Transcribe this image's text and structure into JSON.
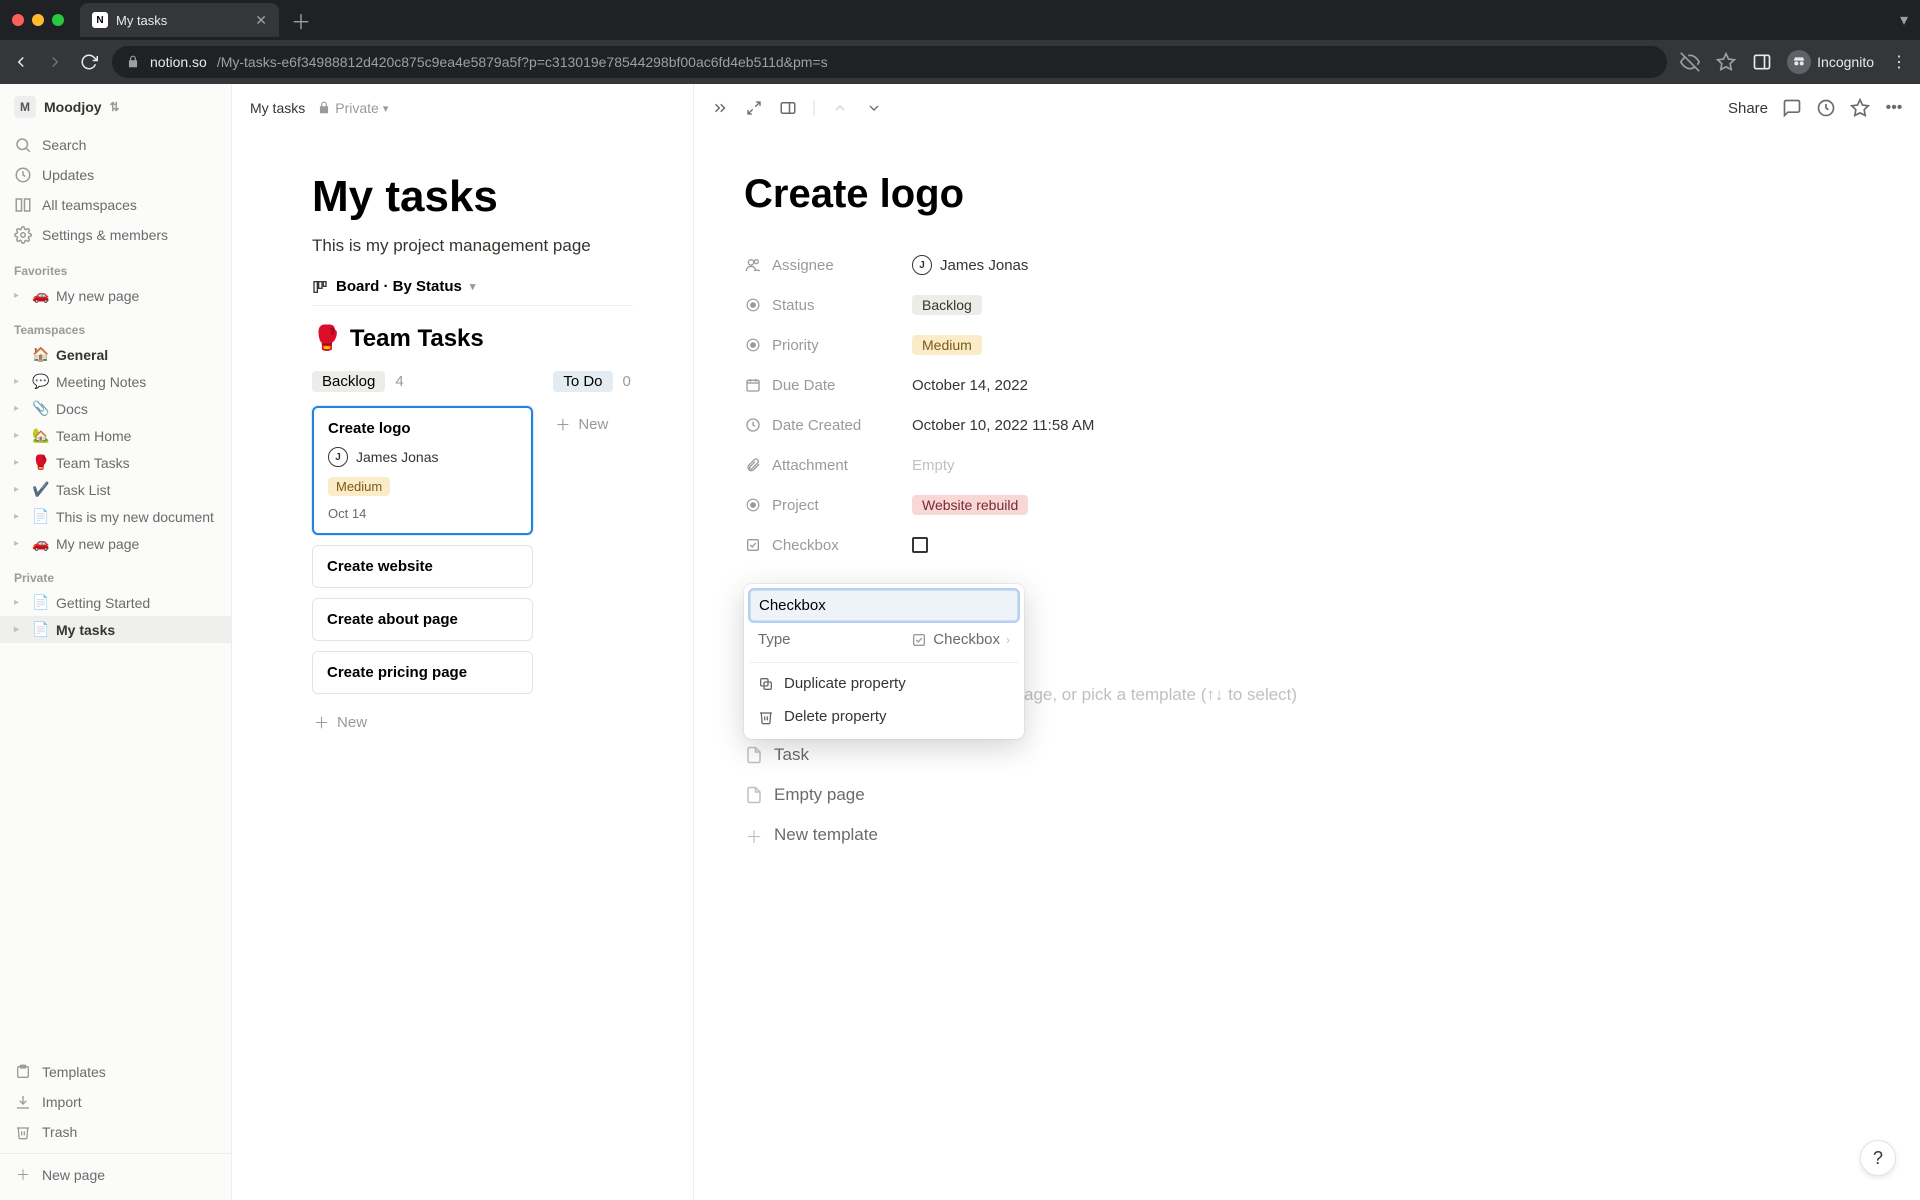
{
  "browser": {
    "tab_title": "My tasks",
    "url_host": "notion.so",
    "url_path": "/My-tasks-e6f34988812d420c875c9ea4e5879a5f?p=c313019e78544298bf00ac6fd4eb511d&pm=s",
    "incognito_label": "Incognito"
  },
  "workspace": {
    "initial": "M",
    "name": "Moodjoy"
  },
  "sidebar_top": [
    {
      "icon": "search-icon",
      "label": "Search"
    },
    {
      "icon": "clock-icon",
      "label": "Updates"
    },
    {
      "icon": "teamspaces-icon",
      "label": "All teamspaces"
    },
    {
      "icon": "gear-icon",
      "label": "Settings & members"
    }
  ],
  "sidebar_sections": {
    "favorites_label": "Favorites",
    "favorites": [
      {
        "emoji": "🚗",
        "label": "My new page"
      }
    ],
    "teamspaces_label": "Teamspaces",
    "teamspaces": [
      {
        "emoji": "🏠",
        "label": "General",
        "top": true
      },
      {
        "emoji": "💬",
        "label": "Meeting Notes"
      },
      {
        "emoji": "📎",
        "label": "Docs"
      },
      {
        "emoji": "🏡",
        "label": "Team Home"
      },
      {
        "emoji": "🥊",
        "label": "Team Tasks"
      },
      {
        "emoji": "✔️",
        "label": "Task List"
      },
      {
        "emoji": "📄",
        "label": "This is my new document"
      },
      {
        "emoji": "🚗",
        "label": "My new page"
      }
    ],
    "private_label": "Private",
    "private": [
      {
        "emoji": "📄",
        "label": "Getting Started"
      },
      {
        "emoji": "📄",
        "label": "My tasks",
        "selected": true
      }
    ]
  },
  "sidebar_bottom": [
    {
      "icon": "template-icon",
      "label": "Templates"
    },
    {
      "icon": "import-icon",
      "label": "Import"
    },
    {
      "icon": "trash-icon",
      "label": "Trash"
    }
  ],
  "new_page_label": "New page",
  "breadcrumb": {
    "page": "My tasks",
    "visibility": "Private"
  },
  "topbar": {
    "share": "Share"
  },
  "page": {
    "title": "My tasks",
    "subtitle": "This is my project management page",
    "view_label": "Board · By Status",
    "db_emoji": "🥊",
    "db_title": "Team Tasks"
  },
  "board": {
    "columns": [
      {
        "name": "Backlog",
        "count": "4",
        "tag_class": "",
        "cards": [
          {
            "title": "Create logo",
            "assignee": "James Jonas",
            "priority": "Medium",
            "date": "Oct 14",
            "selected": true
          },
          {
            "title": "Create website"
          },
          {
            "title": "Create about page"
          },
          {
            "title": "Create pricing page"
          }
        ],
        "add": "New"
      },
      {
        "name": "To Do",
        "count": "0",
        "tag_class": "todo",
        "add": "New"
      }
    ]
  },
  "detail": {
    "title": "Create logo",
    "properties": [
      {
        "icon": "person-icon",
        "label": "Assignee",
        "kind": "person",
        "value": "James Jonas"
      },
      {
        "icon": "status-icon",
        "label": "Status",
        "kind": "tag",
        "tag_class": "backlog",
        "value": "Backlog"
      },
      {
        "icon": "status-icon",
        "label": "Priority",
        "kind": "tag",
        "tag_class": "medium",
        "value": "Medium"
      },
      {
        "icon": "calendar-icon",
        "label": "Due Date",
        "kind": "text",
        "value": "October 14, 2022"
      },
      {
        "icon": "clock-icon",
        "label": "Date Created",
        "kind": "text",
        "value": "October 10, 2022 11:58 AM"
      },
      {
        "icon": "attachment-icon",
        "label": "Attachment",
        "kind": "empty",
        "value": "Empty"
      },
      {
        "icon": "status-icon",
        "label": "Project",
        "kind": "tag",
        "tag_class": "project",
        "value": "Website rebuild"
      },
      {
        "icon": "checkbox-icon",
        "label": "Checkbox",
        "kind": "checkbox"
      }
    ],
    "popover": {
      "name_value": "Checkbox",
      "type_label": "Type",
      "type_value": "Checkbox",
      "duplicate": "Duplicate property",
      "delete": "Delete property"
    },
    "body_placeholder_tail": "age, or pick a template (↑↓ to select)",
    "templates": [
      {
        "icon": "page-icon",
        "label": "Task"
      },
      {
        "icon": "page-icon",
        "label": "Empty page"
      },
      {
        "icon": "plus-icon",
        "label": "New template"
      }
    ]
  },
  "help": "?"
}
